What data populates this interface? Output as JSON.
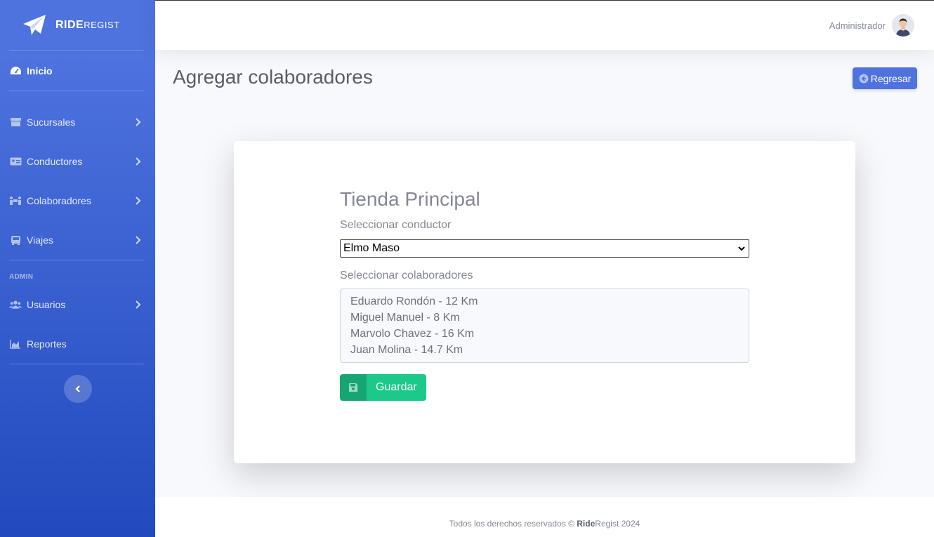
{
  "brand": {
    "bold": "RIDE",
    "rest": "REGIST",
    "icon": "paper-plane-icon"
  },
  "sidebar": {
    "home": {
      "label": "Inicio",
      "icon": "dashboard-icon"
    },
    "items": [
      {
        "label": "Sucursales",
        "icon": "store-icon"
      },
      {
        "label": "Conductores",
        "icon": "id-card-icon"
      },
      {
        "label": "Colaboradores",
        "icon": "people-carry-icon"
      },
      {
        "label": "Viajes",
        "icon": "bus-icon"
      }
    ],
    "admin_heading": "ADMIN",
    "admin_items": [
      {
        "label": "Usuarios",
        "icon": "users-icon"
      },
      {
        "label": "Reportes",
        "icon": "chart-area-icon"
      }
    ],
    "toggle_icon": "chevron-left-icon"
  },
  "topbar": {
    "user_name": "Administrador",
    "avatar_icon": "user-avatar-icon"
  },
  "page": {
    "title": "Agregar colaboradores",
    "back_label": "Regresar"
  },
  "form": {
    "store_name": "Tienda Principal",
    "driver_label": "Seleccionar conductor",
    "driver_selected": "Elmo Maso",
    "collaborators_label": "Seleccionar colaboradores",
    "collaborators": [
      "Eduardo Rondón - 12 Km",
      "Miguel Manuel - 8 Km",
      "Marvolo Chavez - 16 Km",
      "Juan Molina - 14.7 Km"
    ],
    "save_label": "Guardar"
  },
  "footer": {
    "prefix": "Todos los derechos reservados © ",
    "brand_bold": "Ride",
    "brand_rest": "Regist 2024"
  },
  "colors": {
    "primary": "#4e73df",
    "success": "#1cc88a",
    "success_dark": "#17a673"
  }
}
